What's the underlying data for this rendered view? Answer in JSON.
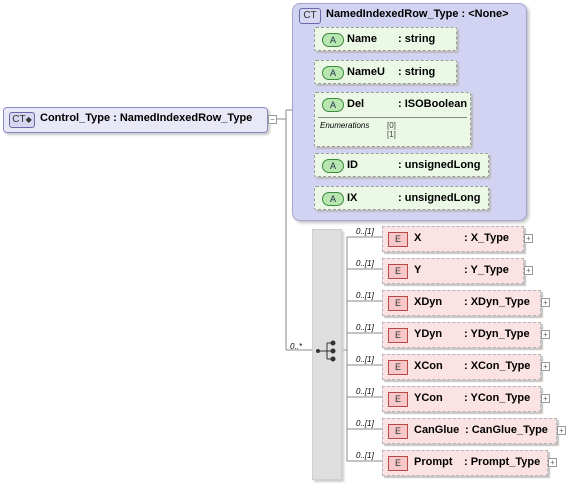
{
  "root": {
    "badge": "CT",
    "label": "Control_Type : NamedIndexedRow_Type"
  },
  "type_panel": {
    "badge": "CT",
    "title": "NamedIndexedRow_Type : <None>"
  },
  "attributes": [
    {
      "badge": "A",
      "name": "Name",
      "type": ": string"
    },
    {
      "badge": "A",
      "name": "NameU",
      "type": ": string"
    },
    {
      "badge": "A",
      "name": "Del",
      "type": ": ISOBoolean",
      "enum_label": "Enumerations",
      "enum_values": [
        "[0]",
        "[1]"
      ]
    },
    {
      "badge": "A",
      "name": "ID",
      "type": ": unsignedLong"
    },
    {
      "badge": "A",
      "name": "IX",
      "type": ": unsignedLong"
    }
  ],
  "sequence": {
    "cardinality": "0..*"
  },
  "elements": [
    {
      "badge": "E",
      "cardinality": "0..[1]",
      "name": "X",
      "type": ": X_Type"
    },
    {
      "badge": "E",
      "cardinality": "0..[1]",
      "name": "Y",
      "type": ": Y_Type"
    },
    {
      "badge": "E",
      "cardinality": "0..[1]",
      "name": "XDyn",
      "type": ": XDyn_Type"
    },
    {
      "badge": "E",
      "cardinality": "0..[1]",
      "name": "YDyn",
      "type": ": YDyn_Type"
    },
    {
      "badge": "E",
      "cardinality": "0..[1]",
      "name": "XCon",
      "type": ": XCon_Type"
    },
    {
      "badge": "E",
      "cardinality": "0..[1]",
      "name": "YCon",
      "type": ": YCon_Type"
    },
    {
      "badge": "E",
      "cardinality": "0..[1]",
      "name": "CanGlue",
      "type": ": CanGlue_Type"
    },
    {
      "badge": "E",
      "cardinality": "0..[1]",
      "name": "Prompt",
      "type": ": Prompt_Type"
    }
  ]
}
